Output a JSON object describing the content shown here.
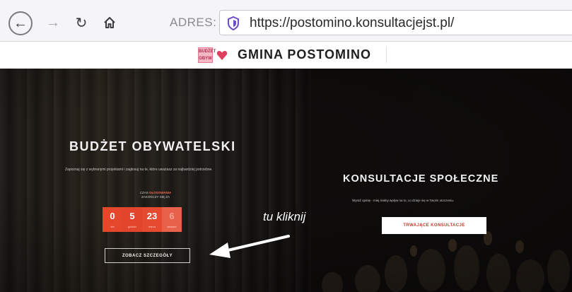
{
  "browser": {
    "address_label": "ADRES:",
    "url": "https://postomino.konsultacjejst.pl/"
  },
  "site": {
    "logo_text": "BUDŻET OBYW",
    "title": "GMINA POSTOMINO"
  },
  "budget": {
    "title": "BUDŻET OBYWATELSKI",
    "subtitle": "Zapoznaj się z wybranymi projektami i zagłosuj na te, które uważasz za najbardziej potrzebne.",
    "time_label_prefix": "CZAS",
    "time_label_highlight": "GŁOSOWANIA",
    "time_label_suffix": "ZAKOŃCZY SIĘ ZA",
    "countdown": [
      {
        "value": "0",
        "unit": "dni"
      },
      {
        "value": "5",
        "unit": "godzin"
      },
      {
        "value": "23",
        "unit": "minut"
      },
      {
        "value": "6",
        "unit": "sekund"
      }
    ],
    "details_button": "ZOBACZ SZCZEGÓŁY"
  },
  "consultations": {
    "title": "KONSULTACJE SPOŁECZNE",
    "subtitle": "Wyraź opinię - miej realny wpływ na to, co dzieje się w Twoim otoczeniu.",
    "ongoing_button": "TRWAJĄCE KONSULTACJE"
  },
  "annotation": {
    "text": "tu kliknij"
  },
  "colors": {
    "accent_red": "#e5472d",
    "hero_bg": "#141110"
  }
}
